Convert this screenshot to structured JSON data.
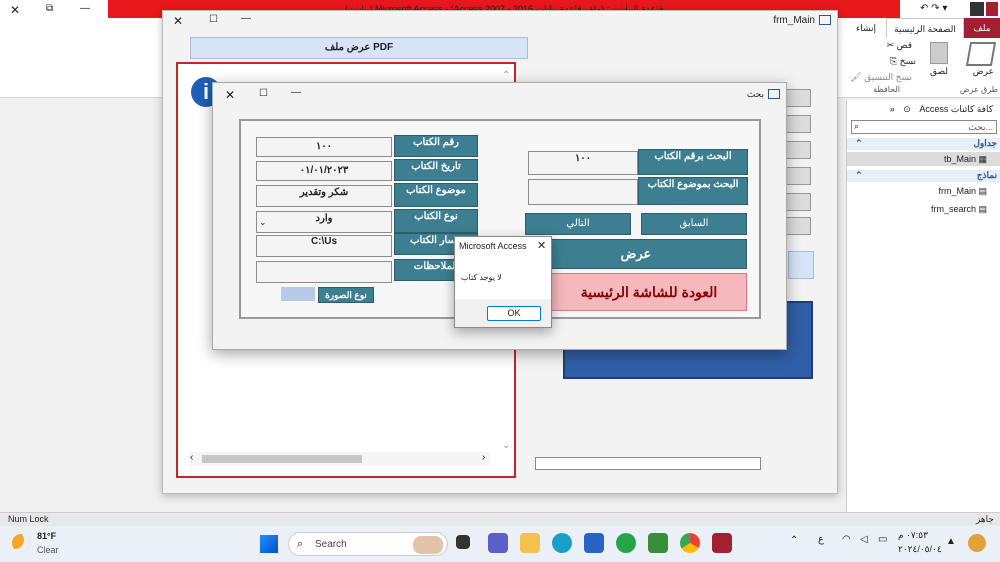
{
  "app": {
    "title_bar_text": "(بيانات) Microsoft Access - (Access 2007 - 2016 ملف قاعدة بيانات) : قاعدة البيانات"
  },
  "ribbon": {
    "tabs": [
      "ملف",
      "الصفحة الرئيسية",
      "إنشاء"
    ],
    "clipboard": {
      "cut": "قص",
      "copy": "نسخ",
      "format_painter": "نسخ التنسيق",
      "paste": "لصق",
      "group": "الحافظة"
    },
    "views": {
      "label": "عرض",
      "group": "طرق عرض"
    }
  },
  "nav": {
    "header": "كافة كائنات Access",
    "search_placeholder": "بحث...",
    "groups": [
      {
        "title": "جداول",
        "items": [
          "tb_Main"
        ]
      },
      {
        "title": "نماذج",
        "items": [
          "frm_Main",
          "frm_search"
        ]
      }
    ]
  },
  "frm_main": {
    "title": "frm_Main",
    "pdf_label": "عرض ملف PDF"
  },
  "frm_search": {
    "title": "بحث",
    "labels": [
      "رقم الكتاب",
      "تاريخ الكتاب",
      "موضوع الكتاب",
      "نوع الكتاب",
      "مسار الكتاب",
      "الملاحظات"
    ],
    "values": [
      "١٠٠",
      "٠١/٠١/٢٠٢٣",
      "شكر وتقدير",
      "وارد",
      "C:\\Us",
      ""
    ],
    "image_type": "نوع الصورة",
    "search_by_number": "البحث برقم الكتاب",
    "search_number_value": "١٠٠",
    "search_by_subject": "البحث بموضوع الكتاب",
    "next": "التالي",
    "previous": "السابق",
    "view": "عرض",
    "back_main": "العودة للشاشة الرئيسية"
  },
  "message_box": {
    "title": "Microsoft Access",
    "text": "لا يوجد كتاب",
    "ok": "OK"
  },
  "status": {
    "num_lock": "Num Lock",
    "ready": "جاهز"
  },
  "taskbar": {
    "weather_temp": "81°F",
    "weather_desc": "Clear",
    "search_label": "Search",
    "time": "٠٧:٥٣ م",
    "date": "٢٠٢٤/٠٥/٠٤",
    "lang": "ع"
  },
  "colors": {
    "accent_red": "#e8171c",
    "teal": "#3d7f90",
    "pink": "#f5b8bc",
    "blue_panel": "#2f5fa8"
  }
}
